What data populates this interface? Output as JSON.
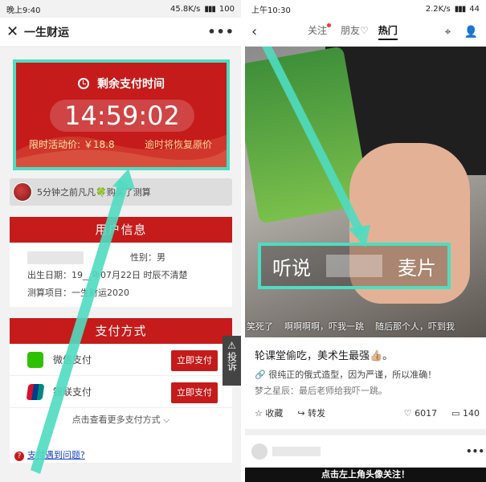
{
  "left": {
    "status": {
      "time": "晚上9:40",
      "net": "45.8K/s",
      "battery": "100"
    },
    "nav": {
      "close": "✕",
      "title": "一生财运",
      "more": "•••"
    },
    "timer": {
      "heading": "剩余支付时间",
      "time": "14:59:02",
      "price": "限时活动价: ￥18.8",
      "restore": "逾时将恢复原价"
    },
    "buyer": {
      "text": "5分钟之前凡凡🍀购买了测算"
    },
    "user_info": {
      "title": "用户信息",
      "gender": "性别：男",
      "birth": "出生日期：19__年07月22日 时辰不清楚",
      "project": "测算项目：一生财运2020"
    },
    "pay": {
      "title": "支付方式",
      "options": [
        {
          "label": "微信支付",
          "button": "立即支付"
        },
        {
          "label": "银联支付",
          "button": "立即支付"
        }
      ],
      "more": "点击查看更多支付方式",
      "help": "支付遇到问题?"
    },
    "report": "投诉"
  },
  "right": {
    "status": {
      "time": "上午10:30",
      "net": "2.2K/s",
      "battery": "44"
    },
    "nav": {
      "tabs": [
        "关注",
        "朋友♡",
        "热门"
      ],
      "active": 2
    },
    "video": {
      "subtitle_left": "听说",
      "subtitle_right": "麦片",
      "danmaku": [
        "笑死了",
        "啊啊啊啊，吓我一跳",
        "随后那个人，吓到我"
      ]
    },
    "post": {
      "title": "轮课堂偷吃，美术生最强👍🏼。",
      "sub": "🔗 很纯正的俄式造型，因为严谨，所以准确！",
      "comment": "梦之星辰：最后老师给我吓一跳。",
      "collect": "收藏",
      "share": "转发",
      "likes": "6017",
      "comments": "140"
    },
    "banner": "点击左上角头像关注！"
  }
}
